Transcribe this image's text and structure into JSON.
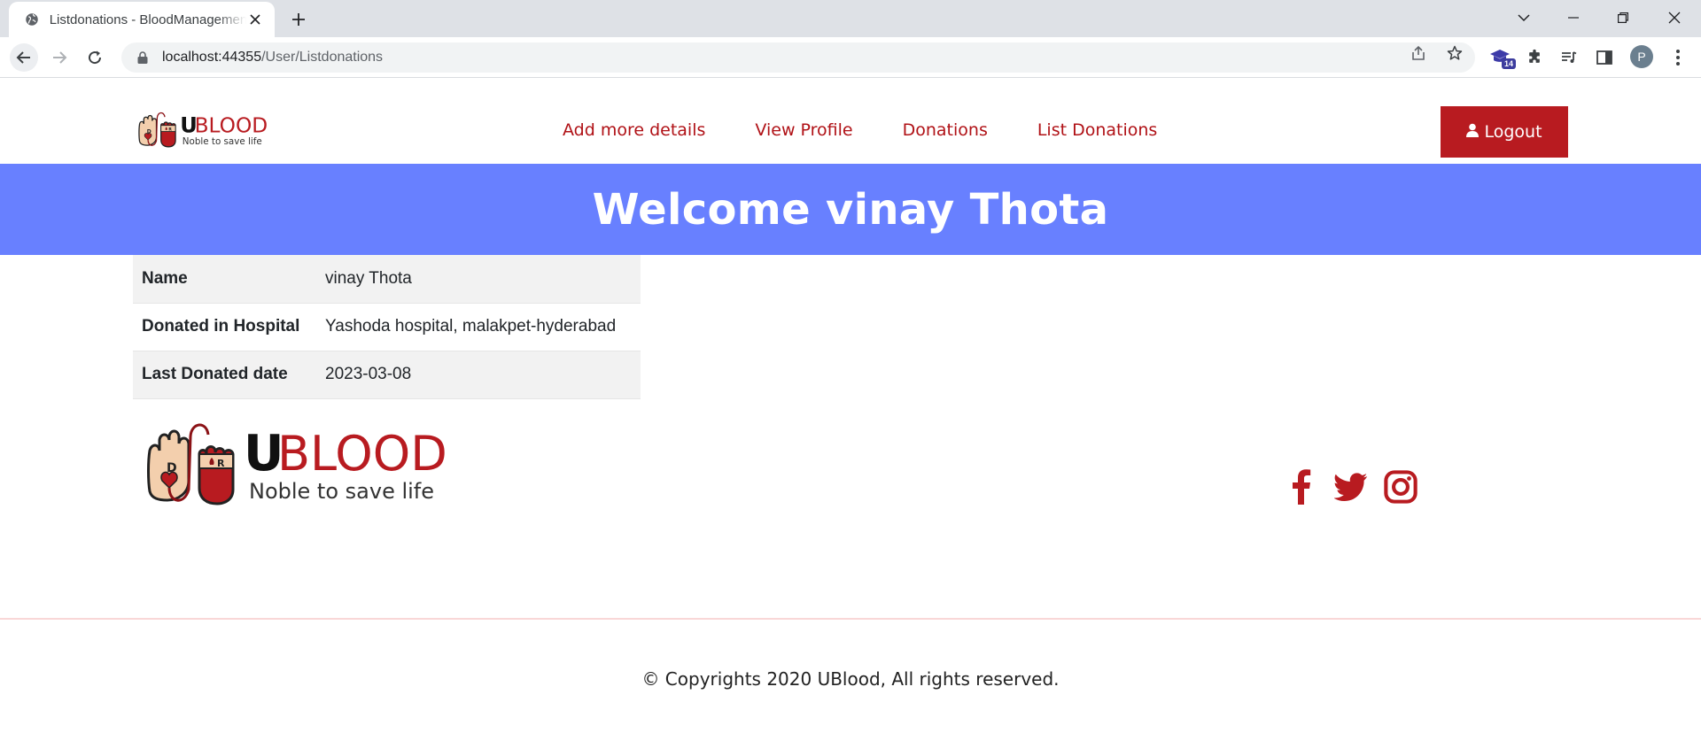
{
  "browser": {
    "tab_title": "Listdonations - BloodManagement",
    "url_host": "localhost:44355",
    "url_path": "/User/Listdonations",
    "extension_badge": "14",
    "profile_initial": "P"
  },
  "brand": {
    "name_u": "U",
    "name_rest": "BLOOD",
    "tagline": "Noble to save life",
    "hand_letter_left": "D",
    "hand_letter_right": "R",
    "primary_color": "#b81b20",
    "banner_color": "#6880ff"
  },
  "nav": {
    "items": [
      {
        "label": "Add more details"
      },
      {
        "label": "View Profile"
      },
      {
        "label": "Donations"
      },
      {
        "label": "List Donations"
      }
    ],
    "logout_label": "Logout"
  },
  "banner": {
    "welcome": "Welcome vinay Thota"
  },
  "details": {
    "rows": [
      {
        "label": "Name",
        "value": "vinay Thota"
      },
      {
        "label": "Donated in Hospital",
        "value": "Yashoda hospital, malakpet-hyderabad"
      },
      {
        "label": "Last Donated date",
        "value": "2023-03-08"
      }
    ]
  },
  "social": [
    "facebook-icon",
    "twitter-icon",
    "instagram-icon"
  ],
  "footer": {
    "copyright": "© Copyrights 2020 UBlood, All rights reserved."
  }
}
